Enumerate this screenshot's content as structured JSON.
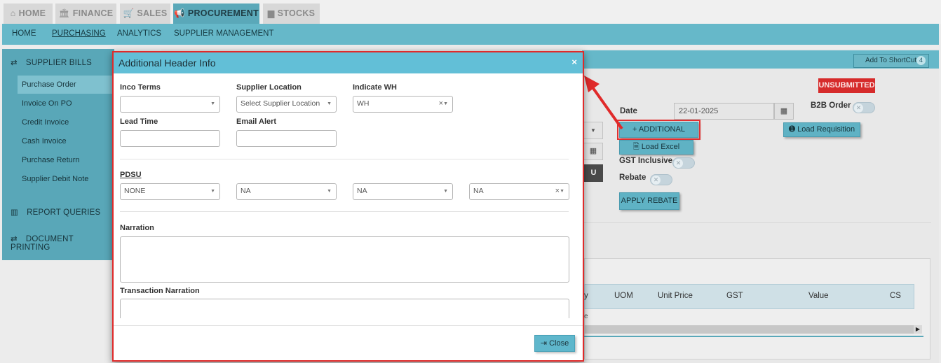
{
  "top_tabs": [
    {
      "icon": "home-icon",
      "label": "HOME"
    },
    {
      "icon": "bank-icon",
      "label": "FINANCE"
    },
    {
      "icon": "cart-icon",
      "label": "SALES"
    },
    {
      "icon": "bullhorn-icon",
      "label": "PROCUREMENT"
    },
    {
      "icon": "bar-chart-icon",
      "label": "STOCKS"
    }
  ],
  "active_top_tab": "PROCUREMENT",
  "sub_nav": [
    "HOME",
    "PURCHASING",
    "ANALYTICS",
    "SUPPLIER MANAGEMENT"
  ],
  "active_sub_nav": "PURCHASING",
  "sidebar": {
    "section_supplier_bills": "SUPPLIER BILLS",
    "items": [
      "Purchase Order",
      "Invoice On PO",
      "Credit Invoice",
      "Cash Invoice",
      "Purchase Return",
      "Supplier Debit Note"
    ],
    "active_item": "Purchase Order",
    "section_report_queries": "REPORT QUERIES",
    "section_document_printing": "DOCUMENT PRINTING"
  },
  "main": {
    "add_to_shortcut": "Add To ShortCut",
    "shortcut_count": "4",
    "status_badge": "UNSUBMITTED",
    "date_label": "Date",
    "date_value": "22-01-2025",
    "b2b_order_label": "B2B Order",
    "additional_button": "+ ADDITIONAL",
    "load_excel_button": "Load Excel",
    "load_requisition_button": "Load Requisition",
    "gst_inclusive_label": "GST Inclusive",
    "rebate_label": "Rebate",
    "apply_rebate_button": "APPLY REBATE",
    "u_button": "U",
    "grid_columns": [
      "y",
      "UOM",
      "Unit Price",
      "GST",
      "Value",
      "CS"
    ],
    "grid_partial_cell": "e"
  },
  "modal": {
    "title": "Additional Header Info",
    "close_x": "×",
    "inco_terms_label": "Inco Terms",
    "inco_terms_value": "",
    "supplier_location_label": "Supplier Location",
    "supplier_location_placeholder": "Select Supplier Location",
    "indicate_wh_label": "Indicate WH",
    "indicate_wh_value": "WH",
    "lead_time_label": "Lead Time",
    "email_alert_label": "Email Alert",
    "pdsu_label": "PDSU",
    "pdsu_values": [
      "NONE",
      "NA",
      "NA",
      "NA"
    ],
    "narration_label": "Narration",
    "transaction_narration_label": "Transaction Narration",
    "close_button": "Close"
  }
}
